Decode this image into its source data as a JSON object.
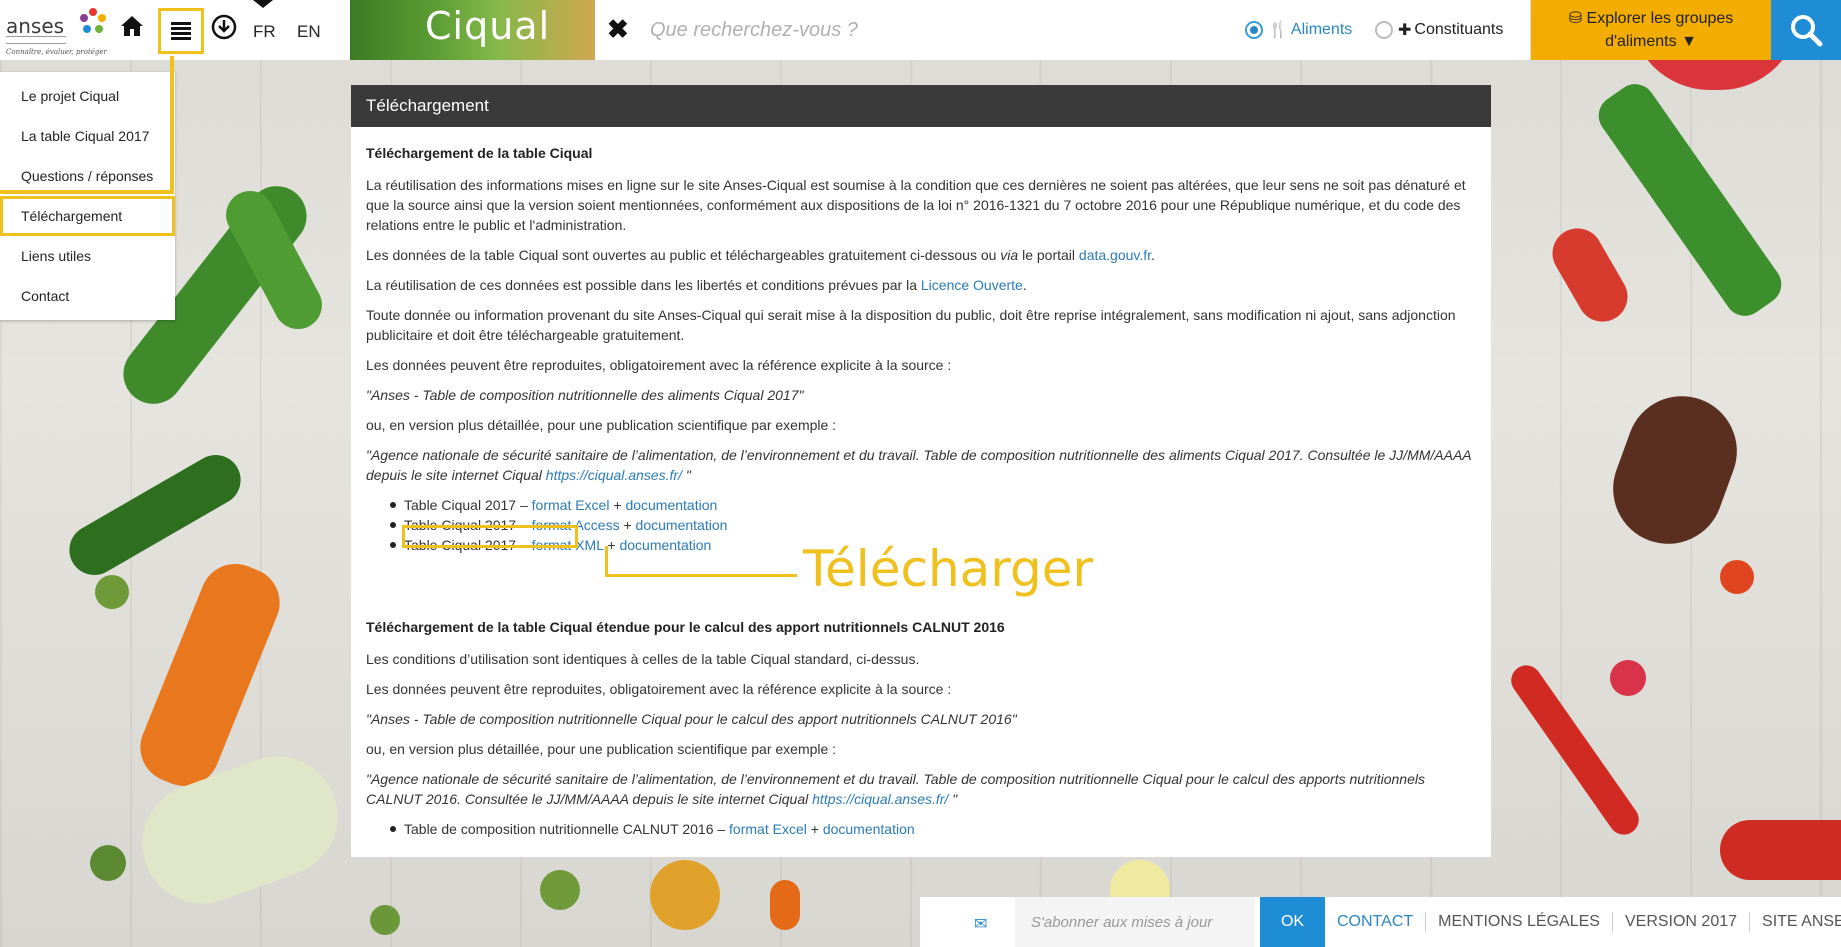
{
  "header": {
    "logo_text": "anses",
    "logo_tagline": "Connaître, évaluer, protéger",
    "app_title": "Ciqual",
    "lang_fr": "FR",
    "lang_en": "EN",
    "search_placeholder": "Que recherchez-vous ?",
    "radio_aliments": "Aliments",
    "radio_constituants": "Constituants",
    "selected_radio": "Aliments",
    "explore_line1": "Explorer les groupes",
    "explore_line2": "d'aliments",
    "accent_color": "#f2ad00",
    "brand_blue": "#1f8dd6"
  },
  "menu": {
    "items": [
      {
        "label": "Le projet Ciqual"
      },
      {
        "label": "La table Ciqual 2017"
      },
      {
        "label": "Questions / réponses"
      },
      {
        "label": "Téléchargement"
      },
      {
        "label": "Liens utiles"
      },
      {
        "label": "Contact"
      }
    ],
    "active": "Téléchargement"
  },
  "panel": {
    "title": "Téléchargement",
    "section1_heading": "Téléchargement de la table Ciqual",
    "p1": "La réutilisation des informations mises en ligne sur le site Anses-Ciqual est soumise à la condition que ces dernières ne soient pas altérées, que leur sens ne soit pas dénaturé et que la source ainsi que la version soient mentionnées, conformément aux dispositions de la loi n° 2016-1321 du 7 octobre 2016 pour une République numérique, et du code des relations entre le public et l'administration.",
    "p2_a": "Les données de la table Ciqual sont ouvertes au public et téléchargeables gratuitement ci-dessous ou ",
    "p2_via": "via",
    "p2_b": " le portail ",
    "p2_link": "data.gouv.fr",
    "p2_end": ".",
    "p3_a": "La réutilisation de ces données est possible dans les libertés et conditions prévues par la ",
    "p3_link": "Licence Ouverte",
    "p3_end": ".",
    "p4": "Toute donnée ou information provenant du site Anses-Ciqual qui serait mise à la disposition du public, doit être reprise intégralement, sans modification ni ajout, sans adjonction publicitaire et doit être téléchargeable gratuitement.",
    "p5": "Les données peuvent être reproduites, obligatoirement avec la référence explicite à la source :",
    "quote1": "\"Anses - Table de composition nutritionnelle des aliments Ciqual 2017\"",
    "p6": "ou, en version plus détaillée, pour une publication scientifique par exemple :",
    "quote2_a": "\"Agence nationale de sécurité sanitaire de l’alimentation, de l’environnement et du travail. Table de composition nutritionnelle des aliments Ciqual 2017. Consultée le JJ/MM/AAAA depuis le site internet Ciqual ",
    "quote2_link": "https://ciqual.anses.fr/",
    "quote2_end": " \"",
    "downloads": [
      {
        "prefix": "Table Ciqual 2017 – ",
        "format": "format Excel",
        "plus": " + ",
        "doc": "documentation"
      },
      {
        "prefix": "Table Ciqual 2017 – ",
        "format": "format Access",
        "plus": " + ",
        "doc": "documentation"
      },
      {
        "prefix": "Table Ciqual 2017 – ",
        "format": "format XML",
        "plus": " + ",
        "doc": "documentation"
      }
    ],
    "annotation": "Télécharger",
    "section2_heading": "Téléchargement de la table Ciqual étendue pour le calcul des apport nutritionnels CALNUT 2016",
    "p7": "Les conditions d’utilisation sont identiques à celles de la table Ciqual standard, ci-dessus.",
    "p8": "Les données peuvent être reproduites, obligatoirement avec la référence explicite à la source :",
    "quote3": "\"Anses - Table de composition nutritionnelle Ciqual pour le calcul des apport nutritionnels CALNUT 2016\"",
    "p9": "ou, en version plus détaillée, pour une publication scientifique par exemple :",
    "quote4_a": "\"Agence nationale de sécurité sanitaire de l’alimentation, de l’environnement et du travail. Table de composition nutritionnelle Ciqual pour le calcul des apports nutritionnels CALNUT 2016. Consultée le JJ/MM/AAAA depuis le site internet Ciqual ",
    "quote4_link": "https://ciqual.anses.fr/",
    "quote4_end": " \"",
    "calnut_prefix": "Table de composition nutritionnelle CALNUT 2016 – ",
    "calnut_format": "format Excel",
    "calnut_plus": " + ",
    "calnut_doc": "documentation"
  },
  "footer": {
    "subscribe_placeholder": "S'abonner aux mises à jour",
    "ok_label": "OK",
    "links": [
      "CONTACT",
      "MENTIONS LÉGALES",
      "VERSION 2017",
      "SITE ANSES"
    ]
  }
}
